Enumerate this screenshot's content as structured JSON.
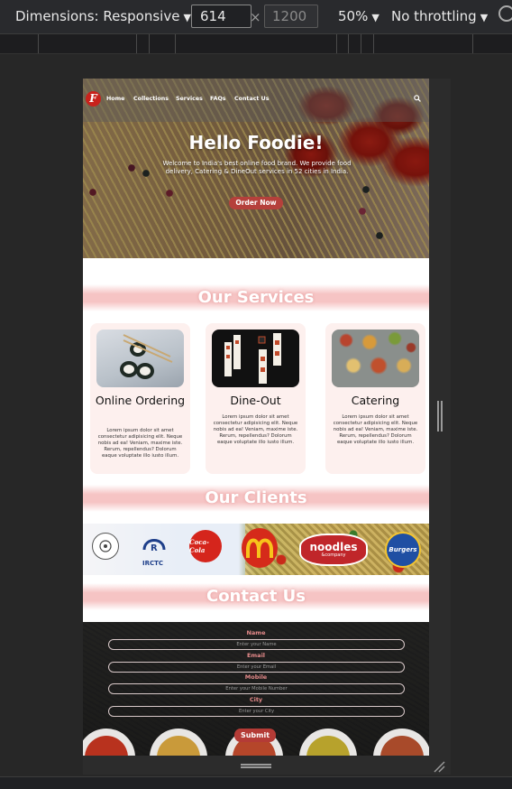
{
  "devtools": {
    "dimensions_label": "Dimensions: Responsive",
    "width_value": "614",
    "height_placeholder": "1200",
    "times_symbol": "×",
    "zoom": "50%",
    "throttling": "No throttling",
    "dropdown_arrow": "▼"
  },
  "site": {
    "logo_letter": "F",
    "nav": [
      "Home",
      "Collections",
      "Services",
      "FAQs",
      "Contact Us"
    ],
    "hero": {
      "title": "Hello Foodie!",
      "text": "Welcome to India's best online food brand. We provide food delivery, Catering & DineOut services in 52 cities in India.",
      "button": "Order Now"
    },
    "services": {
      "title": "Our Services",
      "cards": [
        {
          "title": "Online Ordering",
          "text": "Lorem ipsum dolor sit amet consectetur adipisicing elit. Neque nobis ad ea! Veniam, maxime iste. Rerum, repellendus? Dolorum eaque voluptate illo iusto illum."
        },
        {
          "title": "Dine-Out",
          "text": "Lorem ipsum dolor sit amet consectetur adipisicing elit. Neque nobis ad ea! Veniam, maxime iste. Rerum, repellendus? Dolorum eaque voluptate illo iusto illum."
        },
        {
          "title": "Catering",
          "text": "Lorem ipsum dolor sit amet consectetur adipisicing elit. Neque nobis ad ea! Veniam, maxime iste. Rerum, repellendus? Dolorum eaque voluptate illo iusto illum."
        }
      ]
    },
    "clients": {
      "title": "Our Clients",
      "logos": [
        "IRCTC",
        "Coca-Cola",
        "noodles",
        "&company",
        "Burgers"
      ]
    },
    "contact": {
      "title": "Contact Us",
      "fields": [
        {
          "label": "Name",
          "placeholder": "Enter your Name"
        },
        {
          "label": "Email",
          "placeholder": "Enter your Email"
        },
        {
          "label": "Mobile",
          "placeholder": "Enter your Mobile Number"
        },
        {
          "label": "City",
          "placeholder": "Enter your City"
        }
      ],
      "submit": "Submit"
    }
  },
  "colors": {
    "brand_red": "#c9221c",
    "button_red": "#b5403b",
    "band_pink": "#f5bebe",
    "card_bg": "#fdf0ee"
  }
}
